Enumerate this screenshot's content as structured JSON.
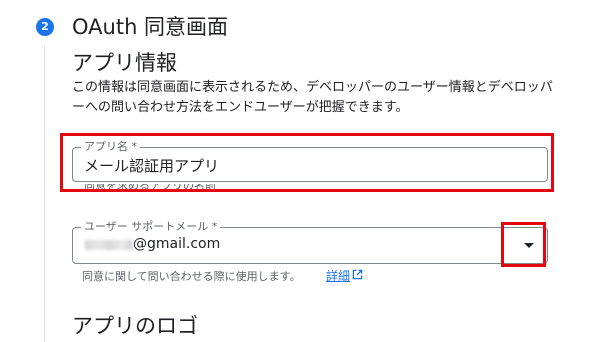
{
  "step": {
    "number": "2",
    "title": "OAuth 同意画面"
  },
  "app_info": {
    "title": "アプリ情報",
    "description": "この情報は同意画面に表示されるため、デベロッパーのユーザー情報とデベロッパーへの問い合わせ方法をエンドユーザーが把握できます。"
  },
  "app_name_field": {
    "label": "アプリ名 *",
    "value": "メール認証用アプリ",
    "helper": "同意を求めるアプリの名前"
  },
  "support_email_field": {
    "label": "ユーザー サポートメール *",
    "value": "@gmail.com",
    "helper": "同意に関して問い合わせる際に使用します。",
    "detail_link": "詳細"
  },
  "logo_section": {
    "title": "アプリのロゴ"
  },
  "colors": {
    "accent": "#1a73e8",
    "highlight": "#e5070f"
  },
  "icons": [
    "step-number-badge",
    "dropdown-arrow-icon",
    "open-in-new-icon"
  ]
}
